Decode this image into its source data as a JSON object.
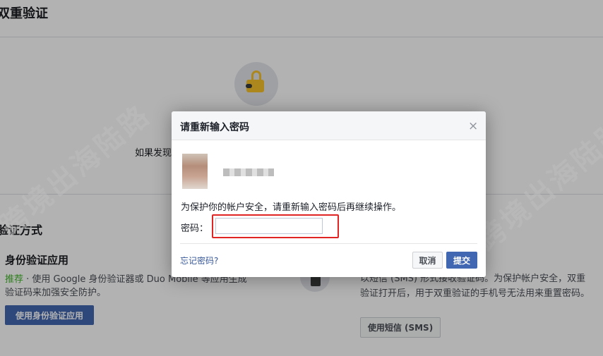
{
  "page": {
    "title": "双重验证",
    "intro_text": "如果发现",
    "section_title": "验证方式",
    "auth_app": {
      "title": "身份验证应用",
      "recommended": "推荐",
      "description": " · 使用 Google 身份验证器或 Duo Mobile 等应用生成验证码来加强安全防护。",
      "button": "使用身份验证应用"
    },
    "sms": {
      "description": "以短信 (SMS) 形式接收验证码。为保护帐户安全，双重验证打开后，用于双重验证的手机号无法用来重置密码。",
      "button": "使用短信 (SMS)"
    }
  },
  "dialog": {
    "title": "请重新输入密码",
    "close": "×",
    "prompt": "为保护你的帐户安全，请重新输入密码后再继续操作。",
    "password_label": "密码：",
    "password_value": "",
    "forgot_link": "忘记密码?",
    "cancel": "取消",
    "submit": "提交"
  },
  "watermark": {
    "text": "跨境出海陆路"
  },
  "colors": {
    "accent": "#4267b2",
    "recommended": "#42b72a",
    "highlight": "#e02424",
    "lock": "#f5c22b"
  },
  "icons": {
    "lock": "unlocked-lock-icon",
    "phone": "phone-icon",
    "close": "close-icon"
  }
}
